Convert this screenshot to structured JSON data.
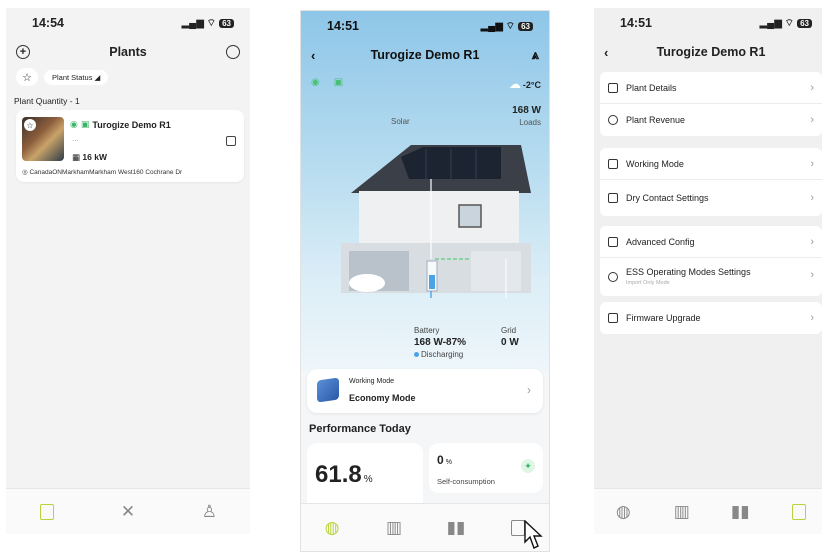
{
  "phone1": {
    "time": "14:54",
    "battery": "63",
    "title": "Plants",
    "filter_chip": "Plant Status",
    "quantity": "Plant Quantity - 1",
    "plant": {
      "name": "Turogize Demo R1",
      "sub": "...",
      "power": "16 kW",
      "address": "CanadaONMarkhamMarkham West160 Cochrane Dr"
    }
  },
  "phone2": {
    "time": "14:51",
    "battery": "63",
    "title": "Turogize Demo R1",
    "temperature": "-2°C",
    "solar_label": "Solar",
    "loads_value": "168 W",
    "loads_label": "Loads",
    "battery_label": "Battery",
    "battery_value": "168 W-87%",
    "battery_status": "Discharging",
    "grid_label": "Grid",
    "grid_value": "0 W",
    "working_mode_label": "Working Mode",
    "working_mode_value": "Economy Mode",
    "performance_title": "Performance Today",
    "metric_big_value": "61.8",
    "metric_big_unit": "%",
    "metric_small_value": "0",
    "metric_small_unit": "%",
    "metric_small_label": "Self-consumption"
  },
  "phone3": {
    "time": "14:51",
    "battery": "63",
    "title": "Turogize Demo R1",
    "menu": {
      "plant_details": "Plant Details",
      "plant_revenue": "Plant Revenue",
      "working_mode": "Working Mode",
      "dry_contact": "Dry Contact Settings",
      "advanced_config": "Advanced Config",
      "ess_modes": "ESS Operating Modes Settings",
      "ess_modes_sub": "Import Only Mode",
      "firmware": "Firmware Upgrade"
    }
  },
  "colors": {
    "accent": "#b7d33a",
    "online": "#3bb56a",
    "battery_dot": "#4ba3e6"
  }
}
